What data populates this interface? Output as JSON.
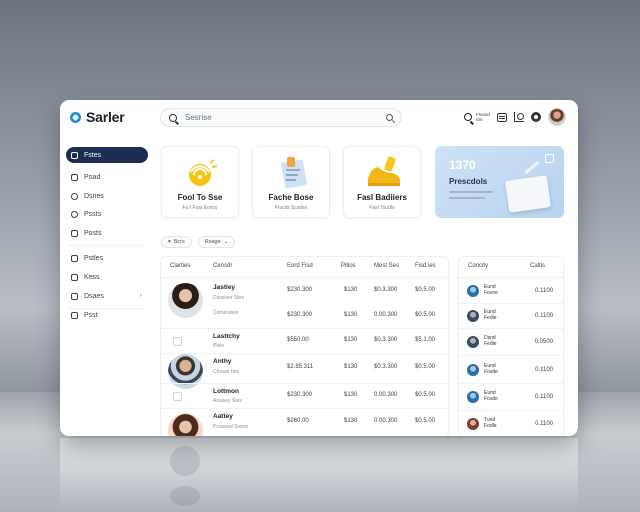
{
  "app": {
    "name": "Sarler"
  },
  "search": {
    "placeholder": "Sesrise"
  },
  "header": {
    "tool_label": "Fmnsd Sin"
  },
  "sidebar": {
    "items": [
      {
        "label": "Fstes",
        "icon": "home-icon",
        "active": true
      },
      {
        "label": "Poad",
        "icon": "document-icon"
      },
      {
        "label": "Dsnes",
        "icon": "clock-icon"
      },
      {
        "label": "Pssts",
        "icon": "people-icon"
      },
      {
        "label": "Posts",
        "icon": "edit-icon"
      },
      {
        "label": "Pstles",
        "icon": "folder-icon"
      },
      {
        "label": "Kess",
        "icon": "grid-icon"
      },
      {
        "label": "Dsaes",
        "icon": "calendar-icon"
      },
      {
        "label": "Psst",
        "icon": "file-icon"
      }
    ]
  },
  "cards": [
    {
      "title": "Fool To Sse",
      "subtitle": "Fo:t Fost Eoricy",
      "icon": "wifi-icon"
    },
    {
      "title": "Fache Bose",
      "subtitle": "Frucils Scsdes",
      "icon": "document-icon"
    },
    {
      "title": "Fasl Badiiers",
      "subtitle": "Fasl Toudls",
      "icon": "sneaker-icon"
    }
  ],
  "promo": {
    "number": "1370",
    "title": "Prescdols"
  },
  "filters": [
    "Bcrs",
    "Rsage"
  ],
  "main_table": {
    "headers": [
      "Clarties",
      "Censdr",
      "Eord Fisd",
      "Pitios",
      "Mest Ses",
      "Fisd:ies"
    ],
    "rows": [
      {
        "name": "Jastley",
        "sub": "Cossiser Stes",
        "c1": "$230.300",
        "c2": "$130",
        "c3": "$0.3.300",
        "c4": "$0.5.00"
      },
      {
        "name": "",
        "sub": "Comersties",
        "c1": "$230.300",
        "c2": "$130",
        "c3": "0.00.300",
        "c4": "$0.5.00"
      },
      {
        "name": "Lasttchy",
        "sub": "Pleis",
        "c1": "$550.00",
        "c2": "$130",
        "c3": "$0.3.300",
        "c4": "$5.1.00"
      },
      {
        "name": "Anthy",
        "sub": "Chewst Ites",
        "c1": "$2.85.311",
        "c2": "$130",
        "c3": "$0.3.300",
        "c4": "$0.5.00"
      },
      {
        "name": "Lottmon",
        "sub": "Ansisey Stes",
        "c1": "$230.300",
        "c2": "$130",
        "c3": "0.00.300",
        "c4": "$0.5.00"
      },
      {
        "name": "Aattey",
        "sub": "Prouseal Sioner",
        "c1": "$260.00",
        "c2": "$130",
        "c3": "0.00.300",
        "c4": "$0.5.00"
      }
    ]
  },
  "side_table": {
    "headers": [
      "Concity",
      "Caltis"
    ],
    "rows": [
      {
        "name": "Eund",
        "sub": "Fovne",
        "value": "0.1100"
      },
      {
        "name": "Eund",
        "sub": "Fedle",
        "value": "0.1100"
      },
      {
        "name": "Dsnd",
        "sub": "Fedle",
        "value": "0.0500"
      },
      {
        "name": "Eund",
        "sub": "Fosde",
        "value": "0.1100"
      },
      {
        "name": "Eund",
        "sub": "Fosde",
        "value": "0.1100"
      },
      {
        "name": "Tund",
        "sub": "Fodle",
        "value": "0.1100"
      }
    ]
  },
  "colors": {
    "accent": "#1b2d52",
    "brand": "#1e8ad8",
    "promo_bg": "#c5dcf4"
  }
}
